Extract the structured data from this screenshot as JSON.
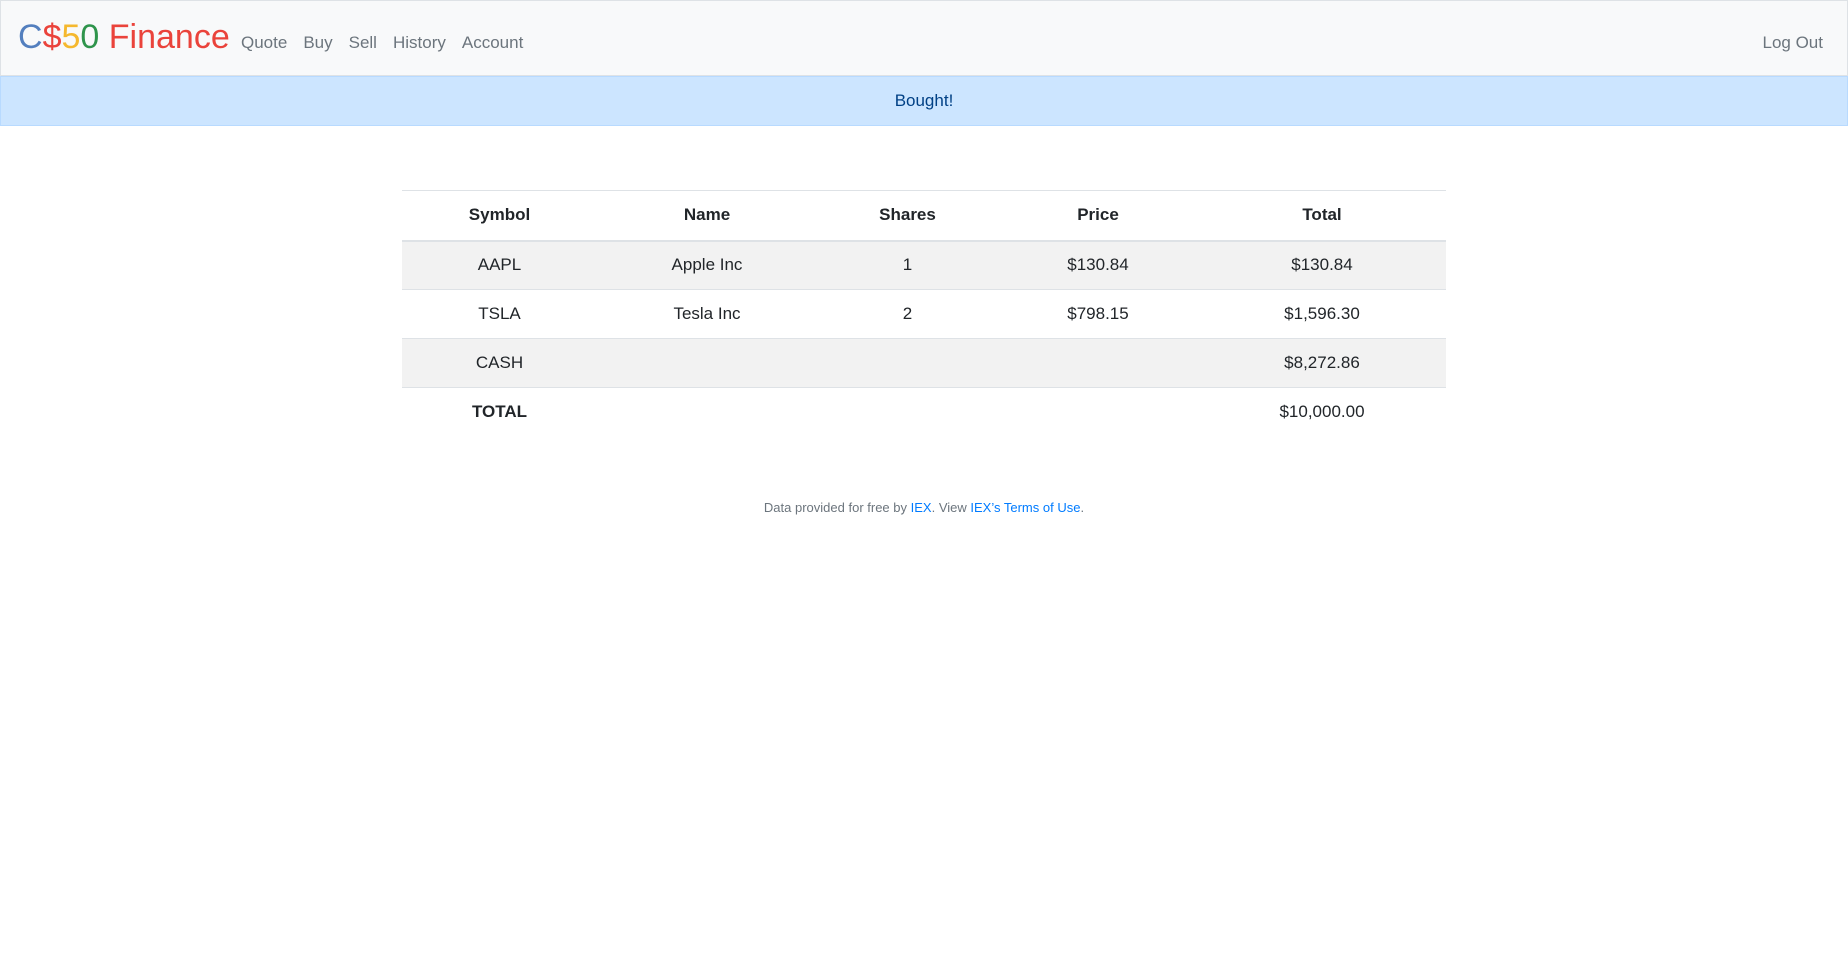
{
  "brand": {
    "c": "C",
    "dollar": "$",
    "five": "5",
    "zero": "0",
    "finance": " Finance"
  },
  "nav": {
    "items": [
      {
        "label": "Quote"
      },
      {
        "label": "Buy"
      },
      {
        "label": "Sell"
      },
      {
        "label": "History"
      },
      {
        "label": "Account"
      }
    ],
    "logout": "Log Out"
  },
  "alert": {
    "message": "Bought!"
  },
  "table": {
    "headers": [
      "Symbol",
      "Name",
      "Shares",
      "Price",
      "Total"
    ],
    "rows": [
      {
        "symbol": "AAPL",
        "name": "Apple Inc",
        "shares": "1",
        "price": "$130.84",
        "total": "$130.84"
      },
      {
        "symbol": "TSLA",
        "name": "Tesla Inc",
        "shares": "2",
        "price": "$798.15",
        "total": "$1,596.30"
      }
    ],
    "cash": {
      "label": "CASH",
      "total": "$8,272.86"
    },
    "grand_total": {
      "label": "TOTAL",
      "total": "$10,000.00"
    }
  },
  "footer": {
    "prefix": "Data provided for free by ",
    "iex_link": "IEX",
    "middle": ". View ",
    "terms_link": "IEX’s Terms of Use",
    "suffix": "."
  },
  "colors": {
    "brand_blue": "#537fbe",
    "brand_red": "#ea433b",
    "brand_yellow": "#f5b82e",
    "brand_green": "#2e944b",
    "alert_bg": "#cce5ff",
    "alert_text": "#004085",
    "link": "#007bff"
  }
}
